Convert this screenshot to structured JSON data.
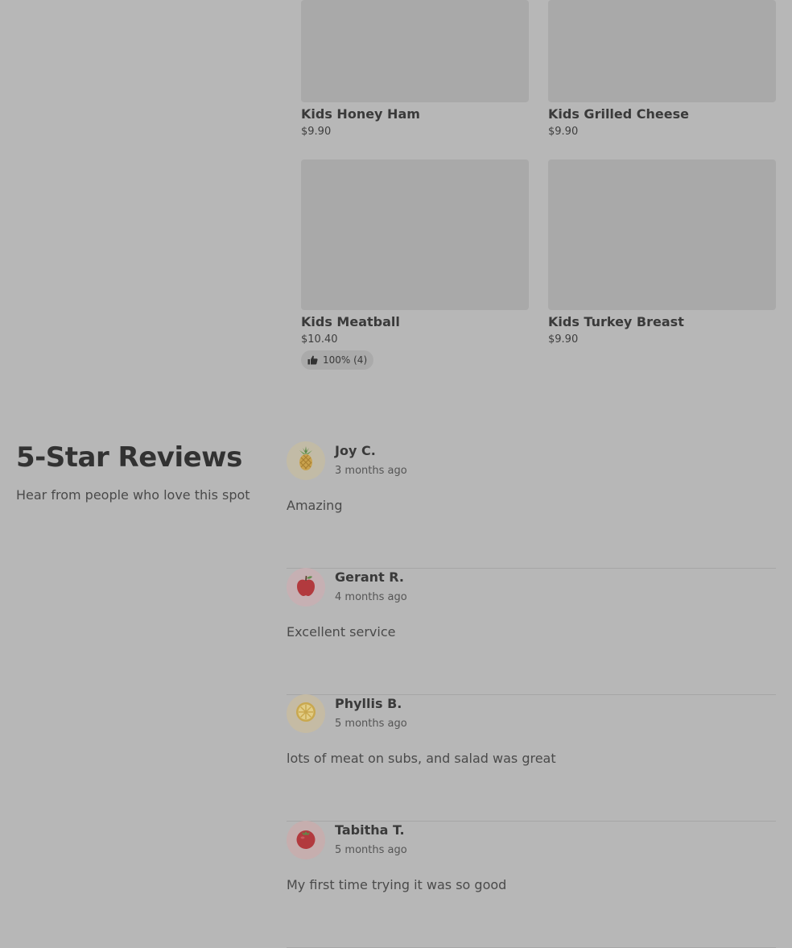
{
  "menu": {
    "items": [
      {
        "name": "Kids Honey Ham",
        "price": "$9.90"
      },
      {
        "name": "Kids Grilled Cheese",
        "price": "$9.90"
      },
      {
        "name": "Kids Meatball",
        "price": "$10.40",
        "rating": "100% (4)"
      },
      {
        "name": "Kids Turkey Breast",
        "price": "$9.90"
      }
    ]
  },
  "reviews_section": {
    "title": "5-Star Reviews",
    "subtitle": "Hear from people who love this spot",
    "reviews": [
      {
        "name": "Joy C.",
        "time": "3 months ago",
        "text": "Amazing",
        "avatar_icon": "pineapple-icon",
        "avatar_bg": "#c2bba6"
      },
      {
        "name": "Gerant R.",
        "time": "4 months ago",
        "text": "Excellent service",
        "avatar_icon": "apple-icon",
        "avatar_bg": "#c6b0b3"
      },
      {
        "name": "Phyllis B.",
        "time": "5 months ago",
        "text": "lots of meat on subs, and salad was great",
        "avatar_icon": "lemon-slice-icon",
        "avatar_bg": "#c5bba4"
      },
      {
        "name": "Tabitha T.",
        "time": "5 months ago",
        "text": "My first time trying it was so good",
        "avatar_icon": "tomato-icon",
        "avatar_bg": "#c6aeae"
      }
    ]
  },
  "colors": {
    "overlay_background": "#b7b7b7",
    "image_placeholder": "#a9a9a9"
  }
}
